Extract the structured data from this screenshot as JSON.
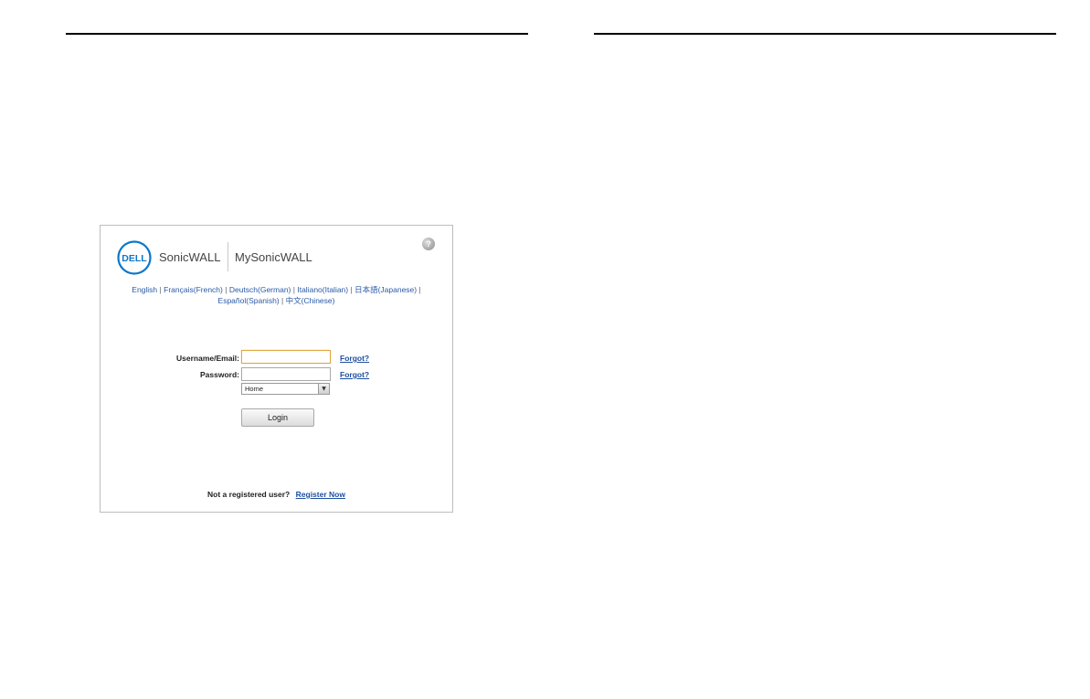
{
  "brand": {
    "logo_text": "DELL",
    "product": "SonicWALL",
    "portal": "MySonicWALL",
    "help_symbol": "?",
    "accent_color": "#0a77c9"
  },
  "languages": {
    "items": [
      "English",
      "Français(French)",
      "Deutsch(German)",
      "Italiano(Italian)",
      "日本語(Japanese)",
      "Español(Spanish)",
      "中文(Chinese)"
    ],
    "separator": "|"
  },
  "form": {
    "username_label": "Username/Email:",
    "username_value": "",
    "password_label": "Password:",
    "password_value": "",
    "forgot_label": "Forgot?",
    "select_value": "Home",
    "login_label": "Login"
  },
  "footer": {
    "prompt": "Not a registered user?",
    "register_label": "Register Now"
  }
}
